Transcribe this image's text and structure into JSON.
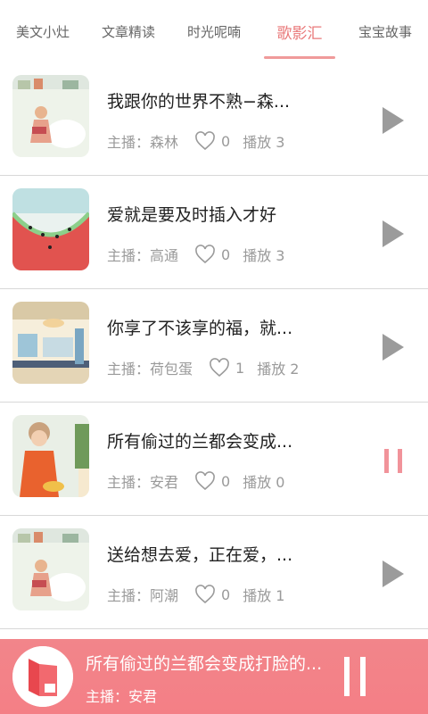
{
  "tabs": [
    {
      "label": "美文小灶",
      "active": false
    },
    {
      "label": "文章精读",
      "active": false
    },
    {
      "label": "时光呢喃",
      "active": false
    },
    {
      "label": "歌影汇",
      "active": true
    },
    {
      "label": "宝宝故事",
      "active": false
    }
  ],
  "items": [
    {
      "title": "我跟你的世界不熟−森...",
      "anchor": "主播：森林",
      "likes": "0",
      "plays": "播放 3",
      "state": "play"
    },
    {
      "title": "爱就是要及时插入才好",
      "anchor": "主播：高通",
      "likes": "0",
      "plays": "播放 3",
      "state": "play"
    },
    {
      "title": "你享了不该享的福，就...",
      "anchor": "主播：荷包蛋",
      "likes": "1",
      "plays": "播放 2",
      "state": "play"
    },
    {
      "title": "所有偷过的兰都会变成...",
      "anchor": "主播：安君",
      "likes": "0",
      "plays": "播放 0",
      "state": "pause"
    },
    {
      "title": "送给想去爱，正在爱，...",
      "anchor": "主播：阿潮",
      "likes": "0",
      "plays": "播放 1",
      "state": "play"
    }
  ],
  "player": {
    "title": "所有偷过的兰都会变成打脸的...",
    "anchor": "主播：安君",
    "state": "pause"
  },
  "colors": {
    "accent": "#e9797a",
    "player_bg": "#f3848a",
    "pause_icon": "#f1939a",
    "play_icon": "#9b9b9b"
  },
  "icons": {
    "heart": "heart-outline-icon",
    "play": "play-icon",
    "pause": "pause-icon"
  }
}
